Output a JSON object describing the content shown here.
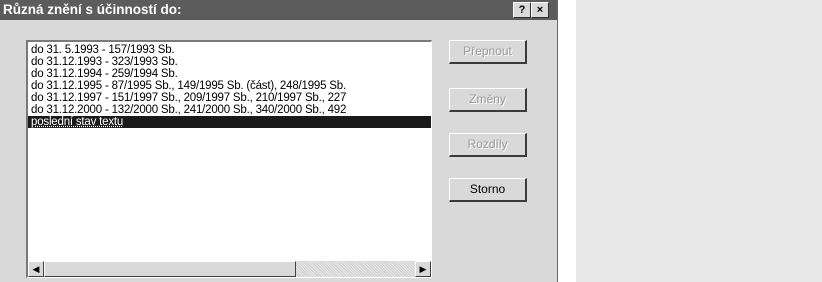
{
  "dialog": {
    "title": "Různá znění s účinností do:",
    "help_label": "?",
    "close_label": "×"
  },
  "list": {
    "items": [
      "do 31. 5.1993 -  157/1993 Sb.",
      "do 31.12.1993 -  323/1993 Sb.",
      "do 31.12.1994 -  259/1994 Sb.",
      "do 31.12.1995 -  87/1995 Sb., 149/1995 Sb. (část), 248/1995 Sb.",
      "do 31.12.1997 -  151/1997 Sb., 209/1997 Sb., 210/1997 Sb., 227",
      "do 31.12.2000 -  132/2000 Sb., 241/2000 Sb., 340/2000 Sb., 492",
      "poslední stav textu"
    ],
    "selected_index": 6
  },
  "scrollbar": {
    "left_arrow": "◀",
    "right_arrow": "▶"
  },
  "buttons": {
    "switch_label": "Přepnout",
    "changes_label": "Změny",
    "diffs_label": "Rozdíly",
    "cancel_label": "Storno"
  }
}
